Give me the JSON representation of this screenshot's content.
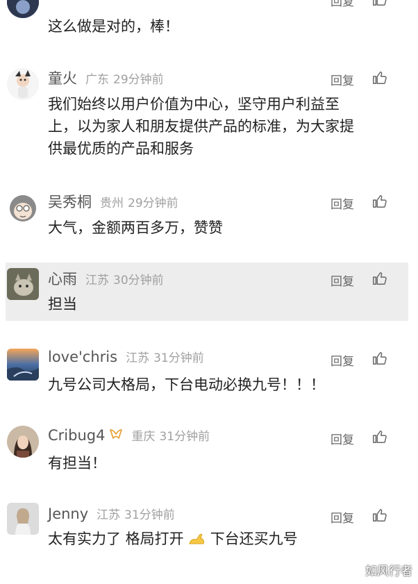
{
  "actions": {
    "reply_label": "回复"
  },
  "comments": [
    {
      "name": "",
      "location": "",
      "time": "",
      "text": "这么做是对的，棒！"
    },
    {
      "name": "童火",
      "location": "广东",
      "time": "29分钟前",
      "lines": [
        "我们始终以用户价值为中心，坚守用户利益至",
        "上，以为家人和朋友提供产品的标准，为大家提",
        "供最优质的产品和服务"
      ]
    },
    {
      "name": "吴秀桐",
      "location": "贵州",
      "time": "29分钟前",
      "text": "大气，金额两百多万，赞赞"
    },
    {
      "name": "心雨",
      "location": "江苏",
      "time": "30分钟前",
      "text": "担当"
    },
    {
      "name": "love'chris",
      "location": "江苏",
      "time": "31分钟前",
      "text": "九号公司大格局，下台电动必换九号！！！"
    },
    {
      "name": "Cribug4",
      "location": "重庆",
      "time": "31分钟前",
      "text": "有担当！"
    },
    {
      "name": "Jenny",
      "location": "江苏",
      "time": "31分钟前",
      "text_before": "太有实力了 格局打开",
      "text_after": "下台还买九号"
    }
  ],
  "watermark": "如风行者",
  "colors": {
    "highlight_bg": "#ededed",
    "name": "#555555",
    "meta": "#a0a0a0"
  }
}
